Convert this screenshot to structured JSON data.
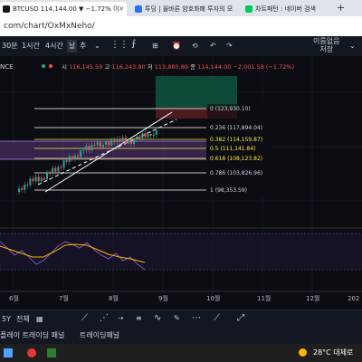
{
  "browser": {
    "tabs": [
      {
        "title": "BTCUSD 114,144.00 ▼ −1.72% 이",
        "favicon_color": "#131722"
      },
      {
        "title": "투딩 | 올바른 암호화폐 투자의 모",
        "favicon_color": "#2f6fed"
      },
      {
        "title": "차트패턴 : 네이버 검색",
        "favicon_color": "#03c75a"
      }
    ],
    "new_tab": "+",
    "url": "com/chart/OxMxNeho/"
  },
  "toolbar": {
    "intervals": [
      "30분",
      "1시간",
      "4시간",
      "날"
    ],
    "add_label": "추",
    "layout_label": "이름없음",
    "layout_sub": "저장"
  },
  "symbol": {
    "exchange": "NCE"
  },
  "ohlc": {
    "o_label": "시",
    "o": "116,145.59",
    "h_label": "고",
    "h": "116,243.80",
    "l_label": "저",
    "l": "113,880.89",
    "c_label": "종",
    "c": "114,144.00",
    "change": "−2,001.58 (−1.72%)"
  },
  "fib_levels": [
    {
      "ratio": "0",
      "label": "0 (123,930.10)",
      "color": "#ffffff"
    },
    {
      "ratio": "0.236",
      "label": "0.236 (117,894.04)",
      "color": "#ffffff"
    },
    {
      "ratio": "0.382",
      "label": "0.382 (114,159.87)",
      "color": "#ffeb3b"
    },
    {
      "ratio": "0.5",
      "label": "0.5 (111,141.84)",
      "color": "#ffeb3b"
    },
    {
      "ratio": "0.618",
      "label": "0.618 (108,123.82)",
      "color": "#ffeb3b"
    },
    {
      "ratio": "0.786",
      "label": "0.786 (103,826.96)",
      "color": "#ffffff"
    },
    {
      "ratio": "1",
      "label": "1 (98,353.59)",
      "color": "#ffffff"
    }
  ],
  "time_axis": [
    "6월",
    "7월",
    "8월",
    "9월",
    "10월",
    "11월",
    "12월",
    "202"
  ],
  "bottom": {
    "range_label": "5Y",
    "all_label": "전체"
  },
  "panels": [
    "플레이 트레이딩 패널",
    "트레이딩패널"
  ],
  "taskbar": {
    "weather": "28°C 대체로",
    "colors": {
      "accent": "#ffeb3b"
    }
  }
}
